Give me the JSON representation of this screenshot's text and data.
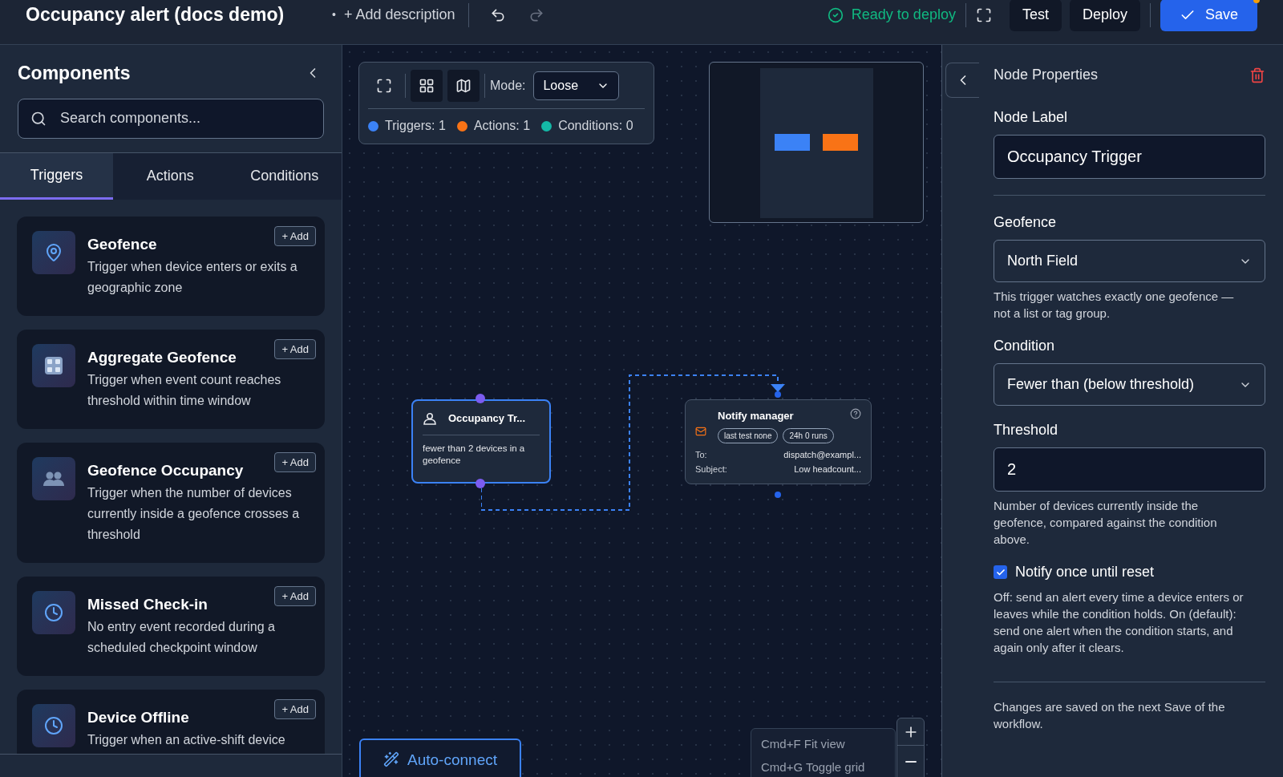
{
  "header": {
    "title": "Occupancy alert (docs demo)",
    "bullet": "•",
    "add_description": "+ Add description",
    "status": "Ready to deploy",
    "buttons": [
      {
        "label": "Test",
        "kind": "plain"
      },
      {
        "label": "Deploy",
        "kind": "plain"
      },
      {
        "label": "Save",
        "kind": "primary"
      }
    ]
  },
  "sidebar": {
    "title": "Components",
    "search": {
      "placeholder": "Search components..."
    },
    "tabs": [
      {
        "label": "Triggers",
        "selected": true
      },
      {
        "label": "Actions",
        "selected": false
      },
      {
        "label": "Conditions",
        "selected": false
      }
    ],
    "items": [
      {
        "kind": "pin",
        "title": "Geofence",
        "description": "Trigger when device enters or exits a geographic zone",
        "add": "+ Add"
      },
      {
        "kind": "numbers",
        "title": "Aggregate Geofence",
        "description": "Trigger when event count reaches threshold within time window",
        "add": "+ Add"
      },
      {
        "kind": "people",
        "title": "Geofence Occupancy",
        "description": "Trigger when the number of devices currently inside a geofence crosses a threshold",
        "add": "+ Add"
      },
      {
        "kind": "clock",
        "title": "Missed Check-in",
        "description": "No entry event recorded during a scheduled checkpoint window",
        "add": "+ Add"
      },
      {
        "kind": "clock",
        "title": "Device Offline",
        "description": "Trigger when an active-shift device",
        "add": "+ Add"
      }
    ]
  },
  "canvas": {
    "mode_label": "Mode:",
    "mode": "Loose",
    "legend": [
      {
        "label": "Triggers: 1",
        "color": "#3b82f6"
      },
      {
        "label": "Actions: 1",
        "color": "#f97316"
      },
      {
        "label": "Conditions: 0",
        "color": "#14b8a6"
      }
    ],
    "nodes": [
      {
        "kind": "trigger",
        "title": "Occupancy Tr...",
        "selected": true,
        "summary": "fewer than 2 devices in a geofence"
      },
      {
        "kind": "action",
        "title": "Notify manager",
        "selected": false,
        "badges": [
          "last test none",
          "24h 0 runs"
        ],
        "rows": [
          {
            "key": "To:",
            "value": "dispatch@exampl..."
          },
          {
            "key": "Subject:",
            "value": "Low headcount..."
          }
        ]
      }
    ],
    "auto_connect": "Auto-connect",
    "shortcuts": [
      "Cmd+F Fit view",
      "Cmd+G Toggle grid"
    ]
  },
  "properties": {
    "title": "Node Properties",
    "fields": [
      {
        "kind": "input",
        "label": "Node Label",
        "value": "Occupancy Trigger"
      },
      {
        "kind": "select",
        "label": "Geofence",
        "value": "North Field",
        "help": "This trigger watches exactly one geofence — not a list or tag group."
      },
      {
        "kind": "select",
        "label": "Condition",
        "value": "Fewer than (below threshold)"
      },
      {
        "kind": "input",
        "label": "Threshold",
        "value": "2",
        "help": "Number of devices currently inside the geofence, compared against the condition above."
      },
      {
        "kind": "checkbox",
        "label": "Notify once until reset",
        "checked": true,
        "help": "Off: send an alert every time a device enters or leaves while the condition holds. On (default): send one alert when the condition starts, and again only after it clears."
      }
    ],
    "footer": "Changes are saved on the next Save of the workflow."
  }
}
